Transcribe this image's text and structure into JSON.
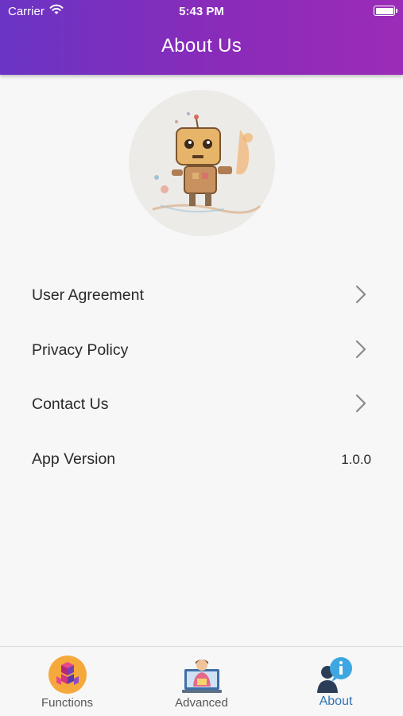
{
  "status_bar": {
    "carrier": "Carrier",
    "time": "5:43 PM"
  },
  "header": {
    "title": "About Us"
  },
  "avatar": {
    "icon": "robot-illustration"
  },
  "menu": [
    {
      "label": "User Agreement",
      "icon": "chevron-right-icon"
    },
    {
      "label": "Privacy Policy",
      "icon": "chevron-right-icon"
    },
    {
      "label": "Contact Us",
      "icon": "chevron-right-icon"
    },
    {
      "label": "App Version",
      "value": "1.0.0"
    }
  ],
  "tabs": [
    {
      "label": "Functions",
      "icon": "functions-cubes-icon",
      "active": false
    },
    {
      "label": "Advanced",
      "icon": "advanced-laptop-icon",
      "active": false
    },
    {
      "label": "About",
      "icon": "about-user-info-icon",
      "active": true
    }
  ],
  "colors": {
    "header_start": "#6a34c4",
    "header_end": "#9b2cb8",
    "active_tab": "#2f73b8",
    "background": "#f7f7f7"
  }
}
